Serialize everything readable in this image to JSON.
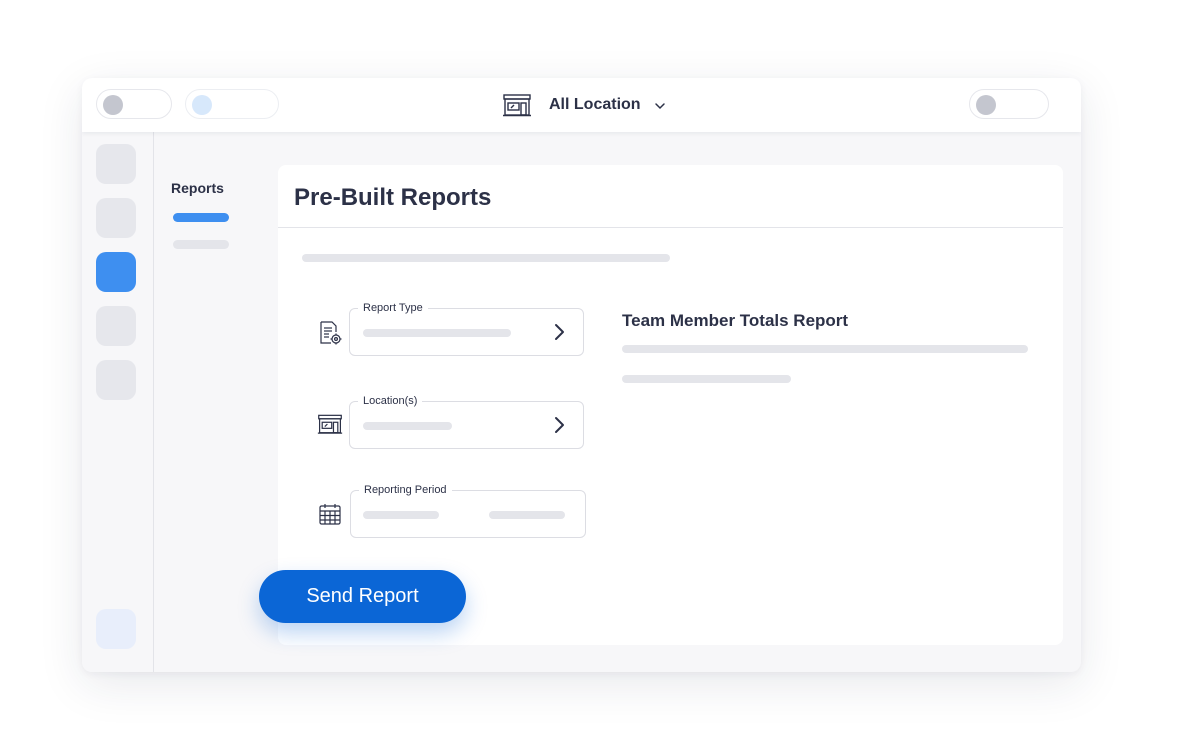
{
  "header": {
    "location_label": "All Location",
    "icons": {
      "location": "storefront-icon",
      "dropdown": "chevron-down-icon"
    }
  },
  "subnav": {
    "title": "Reports"
  },
  "page": {
    "title": "Pre-Built Reports"
  },
  "form": {
    "report_type": {
      "label": "Report Type",
      "icon": "report-settings-icon"
    },
    "locations": {
      "label": "Location(s)",
      "icon": "storefront-icon"
    },
    "reporting_period": {
      "label": "Reporting Period",
      "icon": "calendar-icon"
    }
  },
  "preview": {
    "title": "Team Member Totals Report"
  },
  "actions": {
    "send_label": "Send Report"
  },
  "colors": {
    "accent": "#3e8ff0",
    "primary_button": "#0b66d6",
    "text": "#2c3147",
    "skeleton": "#e4e5ea"
  }
}
